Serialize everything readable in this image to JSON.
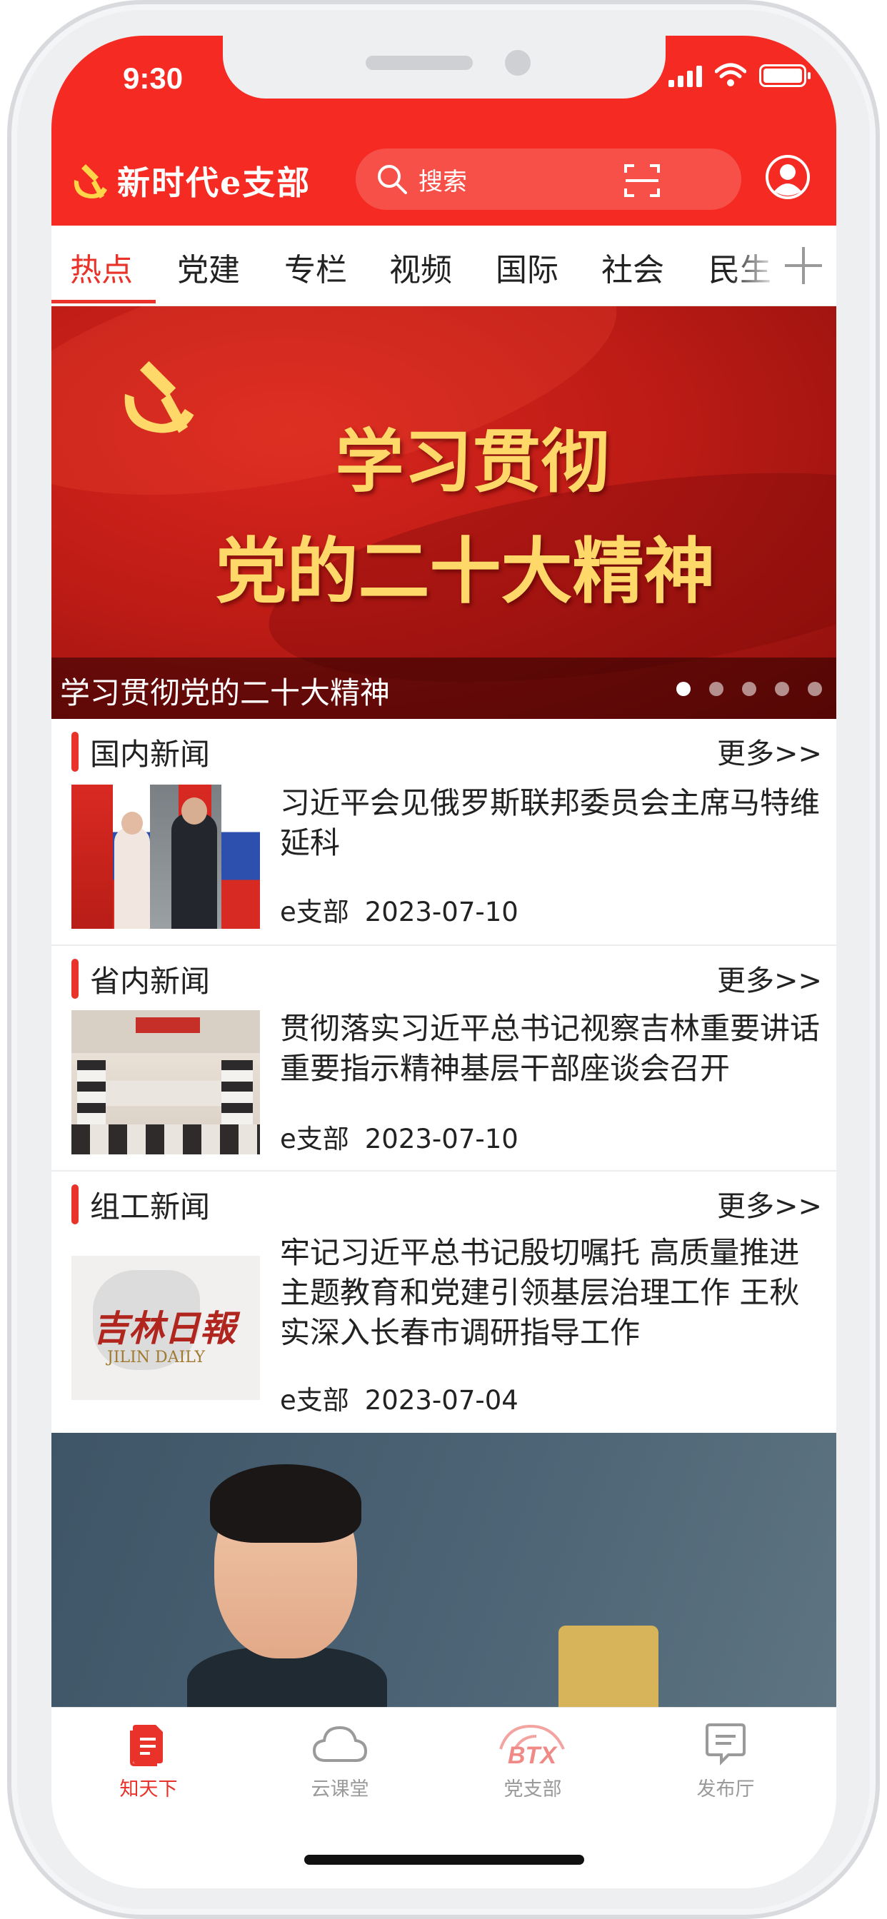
{
  "status_bar": {
    "time": "9:30"
  },
  "header": {
    "app_name": "新时代e支部",
    "search_placeholder": "搜索"
  },
  "tabs": [
    {
      "label": "热点",
      "active": true
    },
    {
      "label": "党建"
    },
    {
      "label": "专栏"
    },
    {
      "label": "视频"
    },
    {
      "label": "国际"
    },
    {
      "label": "社会"
    },
    {
      "label": "民生"
    }
  ],
  "banner": {
    "headline_line1": "学习贯彻",
    "headline_line2": "党的二十大精神",
    "caption": "学习贯彻党的二十大精神",
    "slide_count": 5,
    "active_slide": 1
  },
  "sections": [
    {
      "title": "国内新闻",
      "more": "更多>>",
      "article": {
        "title": "习近平会见俄罗斯联邦委员会主席马特维延科",
        "source": "e支部",
        "date": "2023-07-10"
      }
    },
    {
      "title": "省内新闻",
      "more": "更多>>",
      "article": {
        "title": "贯彻落实习近平总书记视察吉林重要讲话重要指示精神基层干部座谈会召开",
        "source": "e支部",
        "date": "2023-07-10"
      }
    },
    {
      "title": "组工新闻",
      "more": "更多>>",
      "article": {
        "title": "牢记习近平总书记殷切嘱托 高质量推进主题教育和党建引领基层治理工作 王秋实深入长春市调研指导工作",
        "source": "e支部",
        "date": "2023-07-04",
        "thumb_logo": "吉林日報",
        "thumb_logo_en": "JILIN DAILY"
      }
    }
  ],
  "bottom_nav": [
    {
      "label": "知天下",
      "icon": "document-icon",
      "active": true
    },
    {
      "label": "云课堂",
      "icon": "cloud-icon"
    },
    {
      "label": "党支部",
      "icon": "btx-logo-icon",
      "logo_text": "BTX"
    },
    {
      "label": "发布厅",
      "icon": "message-icon"
    }
  ],
  "colors": {
    "brand_red": "#f52a22",
    "accent_red": "#e8322a",
    "banner_gold": "#ffd86a"
  }
}
